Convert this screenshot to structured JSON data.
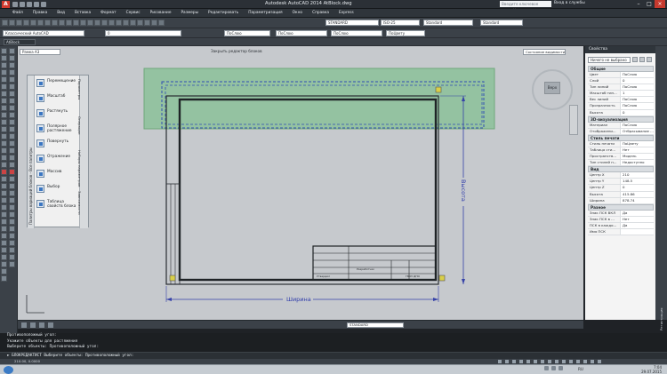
{
  "title_bar": {
    "logo_letter": "A",
    "title": "Autodesk AutoCAD 2014  AtBlock.dwg",
    "search_placeholder": "Введите ключевое слово/фразу",
    "user": "Вход в службы",
    "minimize": "–",
    "maximize": "□",
    "close": "×"
  },
  "menu": [
    "Файл",
    "Правка",
    "Вид",
    "Вставка",
    "Формат",
    "Сервис",
    "Рисование",
    "Размеры",
    "Редактировать",
    "Параметризация",
    "Окно",
    "Справка",
    "Express"
  ],
  "toolbars": {
    "workspace": "Классический AutoCAD",
    "layer": "0",
    "color": "ПоСлою",
    "linetype": "ПоСлою",
    "lineweight": "ПоСлою",
    "plotstyle": "ПоЦвету",
    "textstyle": "STANDARD",
    "dimstyle": "ISO-25",
    "tablestyle": "Standard",
    "mleaderstyle": "Standard",
    "current_drawing": "AtBlock"
  },
  "block_editor": {
    "block_name": "Рамка А3",
    "close_editor": "Закрыть редактор блоков",
    "visibility_state": "Состояние видимости0"
  },
  "palette": {
    "side_label": "Палитры вариаций блоков - Все палитры",
    "items": [
      "Перемещение",
      "Масштаб",
      "Растянуть",
      "Полярное растяжение",
      "Повернуть",
      "Отражение",
      "Массив",
      "Выбор",
      "Таблица свойств блока"
    ],
    "tabs": [
      "Параметры",
      "Операции",
      "Наборы параметров",
      "Зависимости"
    ]
  },
  "drawing": {
    "dim_width": "Ширина",
    "dim_height": "Высота",
    "title_block": {
      "row1": "Разработчик",
      "row2": "Утвердил",
      "stamp": "ГБОУ ДПО"
    }
  },
  "viewcube": {
    "face": "Верх",
    "compass": "З"
  },
  "properties": {
    "title": "Свойства",
    "selection": "Ничего не выбрано",
    "sections": [
      {
        "name": "Общие",
        "rows": [
          [
            "Цвет",
            "ПоСлою"
          ],
          [
            "Слой",
            "0"
          ],
          [
            "Тип линий",
            "ПоСлою"
          ],
          [
            "Масштаб тип...",
            "1"
          ],
          [
            "Вес линий",
            "ПоСлою"
          ],
          [
            "Прозрачность",
            "ПоСлою"
          ],
          [
            "Высота",
            "0"
          ]
        ]
      },
      {
        "name": "3D-визуализация",
        "rows": [
          [
            "Материал",
            "ПоСлою"
          ],
          [
            "Отображени...",
            "Отбрасывание ..."
          ]
        ]
      },
      {
        "name": "Стиль печати",
        "rows": [
          [
            "Стиль печати",
            "ПоЦвету"
          ],
          [
            "Таблица сти...",
            "Нет"
          ],
          [
            "Пространств...",
            "Модель"
          ],
          [
            "Тип стилей п...",
            "Недоступно"
          ]
        ]
      },
      {
        "name": "Вид",
        "rows": [
          [
            "Центр X",
            "210"
          ],
          [
            "Центр Y",
            "148.5"
          ],
          [
            "Центр Z",
            "0"
          ],
          [
            "Высота",
            "415.86"
          ],
          [
            "Ширина",
            "878.74"
          ]
        ]
      },
      {
        "name": "Разное",
        "rows": [
          [
            "Знак ПСК ВКЛ",
            "Да"
          ],
          [
            "Знак ПСК в ...",
            "Нет"
          ],
          [
            "ПСК в каждо...",
            "Да"
          ],
          [
            "Имя ПСК",
            ""
          ]
        ]
      }
    ],
    "side_label": "Регистрация"
  },
  "layout": {
    "tabs_style": "STANDARD"
  },
  "command": {
    "history": [
      "Противоположный угол:",
      "Укажите объекты для растяжения",
      "Выберите объекты: Противоположный угол:"
    ],
    "prompt": "► БЛОКРЕДАКТИСТ Выберите объекты: Противоположный угол:"
  },
  "status": {
    "coords": "210.00, 0.0000"
  },
  "taskbar": {
    "lang": "RU",
    "time": "7:04",
    "date": "29.07.2015"
  }
}
